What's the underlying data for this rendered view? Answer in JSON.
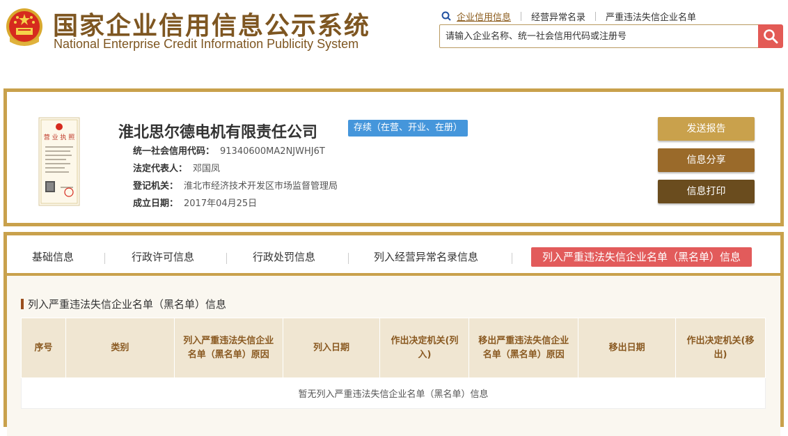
{
  "header": {
    "title_cn": "国家企业信用信息公示系统",
    "title_en": "National Enterprise Credit Information Publicity System",
    "links": [
      "企业信用信息",
      "经营异常名录",
      "严重违法失信企业名单"
    ],
    "search_placeholder": "请输入企业名称、统一社会信用代码或注册号"
  },
  "company": {
    "name": "淮北思尔德电机有限责任公司",
    "status": "存续（在营、开业、在册）",
    "credit_code_label": "统一社会信用代码：",
    "credit_code": "91340600MA2NJWHJ6T",
    "legal_rep_label": "法定代表人：",
    "legal_rep": "邓国凤",
    "registrar_label": "登记机关：",
    "registrar": "淮北市经济技术开发区市场监督管理局",
    "established_label": "成立日期：",
    "established": "2017年04月25日",
    "license_label": "营业执照"
  },
  "actions": {
    "send_report": "发送报告",
    "share": "信息分享",
    "print": "信息打印"
  },
  "tabs": [
    "基础信息",
    "行政许可信息",
    "行政处罚信息",
    "列入经营异常名录信息",
    "列入严重违法失信企业名单（黑名单）信息"
  ],
  "section": {
    "title": "列入严重违法失信企业名单（黑名单）信息",
    "columns": [
      "序号",
      "类别",
      "列入严重违法失信企业名单（黑名单）原因",
      "列入日期",
      "作出决定机关(列入)",
      "移出严重违法失信企业名单（黑名单）原因",
      "移出日期",
      "作出决定机关(移出)"
    ],
    "empty_text": "暂无列入严重违法失信企业名单（黑名单）信息"
  },
  "colors": {
    "brand_brown": "#7e5621",
    "frame_gold": "#c9a14c",
    "active_tab_red": "#e25b5b",
    "status_blue": "#4596db",
    "btn_send": "#c9a14c",
    "btn_share": "#9a6a2a",
    "btn_print": "#6a4c1e"
  }
}
